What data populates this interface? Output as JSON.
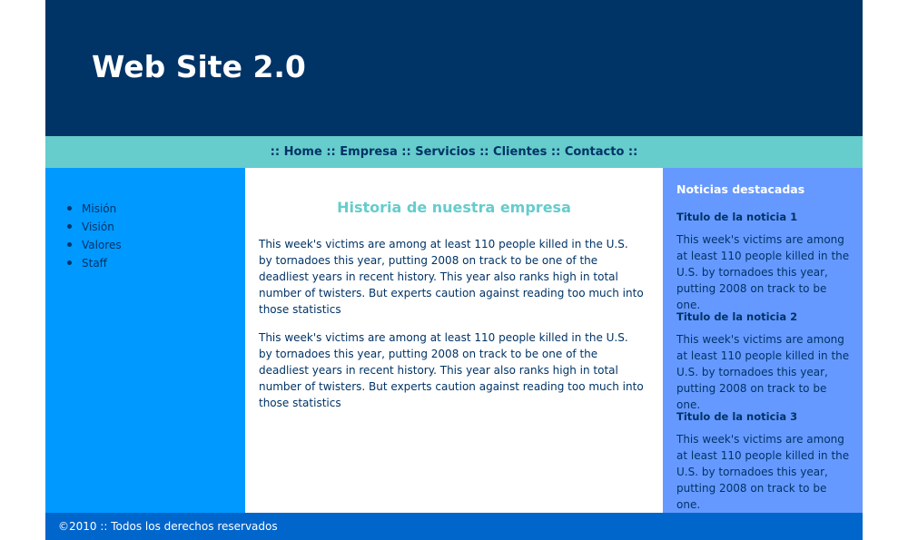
{
  "header": {
    "title": "Web Site 2.0"
  },
  "nav": {
    "sep": "::",
    "items": [
      {
        "label": "Home"
      },
      {
        "label": "Empresa"
      },
      {
        "label": "Servicios"
      },
      {
        "label": "Clientes"
      },
      {
        "label": "Contacto"
      }
    ]
  },
  "sidebar": {
    "items": [
      {
        "label": "Misión"
      },
      {
        "label": "Visión"
      },
      {
        "label": "Valores"
      },
      {
        "label": "Staff"
      }
    ]
  },
  "main": {
    "title": "Historia de nuestra empresa",
    "paragraphs": [
      "This week's victims are among at least 110 people killed in the U.S. by tornadoes this year, putting 2008 on track to be one of the deadliest years in recent history. This year also ranks high in total number of twisters. But experts caution against reading too much into those statistics",
      "This week's victims are among at least 110 people killed in the U.S. by tornadoes this year, putting 2008 on track to be one of the deadliest years in recent history. This year also ranks high in total number of twisters. But experts caution against reading too much into those statistics"
    ]
  },
  "news": {
    "heading": "Noticias destacadas",
    "items": [
      {
        "title": "Titulo de la noticia 1",
        "body": "This week's victims are among at least 110 people killed in the U.S. by tornadoes this year, putting 2008 on track to be one."
      },
      {
        "title": "Titulo de la noticia 2",
        "body": "This week's victims are among at least 110 people killed in the U.S. by tornadoes this year, putting 2008 on track to be one."
      },
      {
        "title": "Titulo de la noticia 3",
        "body": "This week's victims are among at least 110 people killed in the U.S. by tornadoes this year, putting 2008 on track to be one."
      }
    ]
  },
  "footer": {
    "text": "©2010 :: Todos los derechos reservados"
  },
  "colors": {
    "header_bg": "#003366",
    "nav_bg": "#66cccc",
    "sidebar_bg": "#0099ff",
    "news_bg": "#6699ff",
    "footer_bg": "#0066cc",
    "accent_title": "#66cccc"
  }
}
